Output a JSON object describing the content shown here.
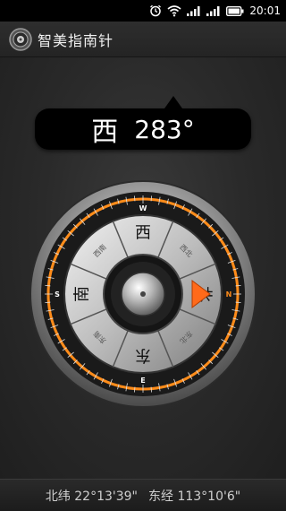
{
  "status_bar": {
    "time": "20:01",
    "icons": [
      "alarm-icon",
      "wifi-icon",
      "signal-1-icon",
      "signal-2-icon",
      "battery-icon"
    ]
  },
  "app": {
    "title": "智美指南针"
  },
  "heading": {
    "direction": "西",
    "degrees": "283°"
  },
  "compass": {
    "sectors": [
      {
        "label": "西",
        "angle": 0
      },
      {
        "label": "西北",
        "angle": 45
      },
      {
        "label": "北",
        "angle": 90
      },
      {
        "label": "东北",
        "angle": 135
      },
      {
        "label": "东",
        "angle": 180
      },
      {
        "label": "东南",
        "angle": 225
      },
      {
        "label": "南",
        "angle": 270
      },
      {
        "label": "西南",
        "angle": 315
      }
    ],
    "ring_letters": [
      {
        "label": "W",
        "angle": 0
      },
      {
        "label": "N",
        "angle": 90
      },
      {
        "label": "E",
        "angle": 180
      },
      {
        "label": "S",
        "angle": 270
      }
    ],
    "pointer_color": "#ff6a1a",
    "accent_color": "#ff8c1a"
  },
  "location": {
    "latitude": "北纬 22°13'39\"",
    "longitude": "东经 113°10'6\""
  }
}
